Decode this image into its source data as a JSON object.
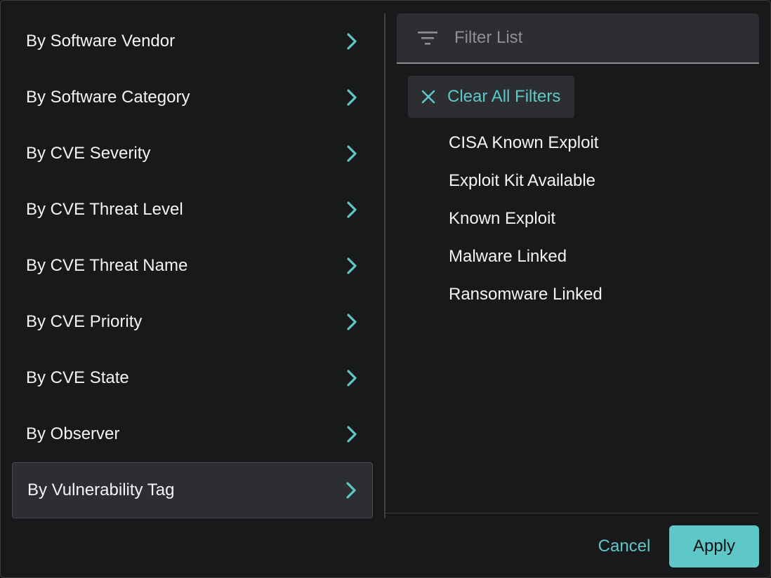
{
  "categories": [
    {
      "label": "By Software Vendor",
      "icon": "chevron-right-icon"
    },
    {
      "label": "By Software Category",
      "icon": "chevron-right-icon"
    },
    {
      "label": "By CVE Severity",
      "icon": "chevron-right-icon"
    },
    {
      "label": "By CVE Threat Level",
      "icon": "chevron-right-icon"
    },
    {
      "label": "By CVE Threat Name",
      "icon": "chevron-right-icon"
    },
    {
      "label": "By CVE Priority",
      "icon": "chevron-right-icon"
    },
    {
      "label": "By CVE State",
      "icon": "chevron-right-icon"
    },
    {
      "label": "By Observer",
      "icon": "chevron-right-icon"
    },
    {
      "label": "By Vulnerability Tag",
      "icon": "chevron-right-icon",
      "selected": true
    }
  ],
  "search": {
    "placeholder": "Filter List",
    "value": "",
    "icon": "filter-lines-icon"
  },
  "clear_filters": {
    "label": "Clear All Filters",
    "icon": "close-icon"
  },
  "tags": [
    "CISA Known Exploit",
    "Exploit Kit Available",
    "Known Exploit",
    "Malware Linked",
    "Ransomware Linked"
  ],
  "footer": {
    "cancel_label": "Cancel",
    "apply_label": "Apply"
  },
  "colors": {
    "accent": "#5ec8c8",
    "background": "#18191a",
    "surface": "#2d2e31",
    "text": "#f3f4f5"
  }
}
